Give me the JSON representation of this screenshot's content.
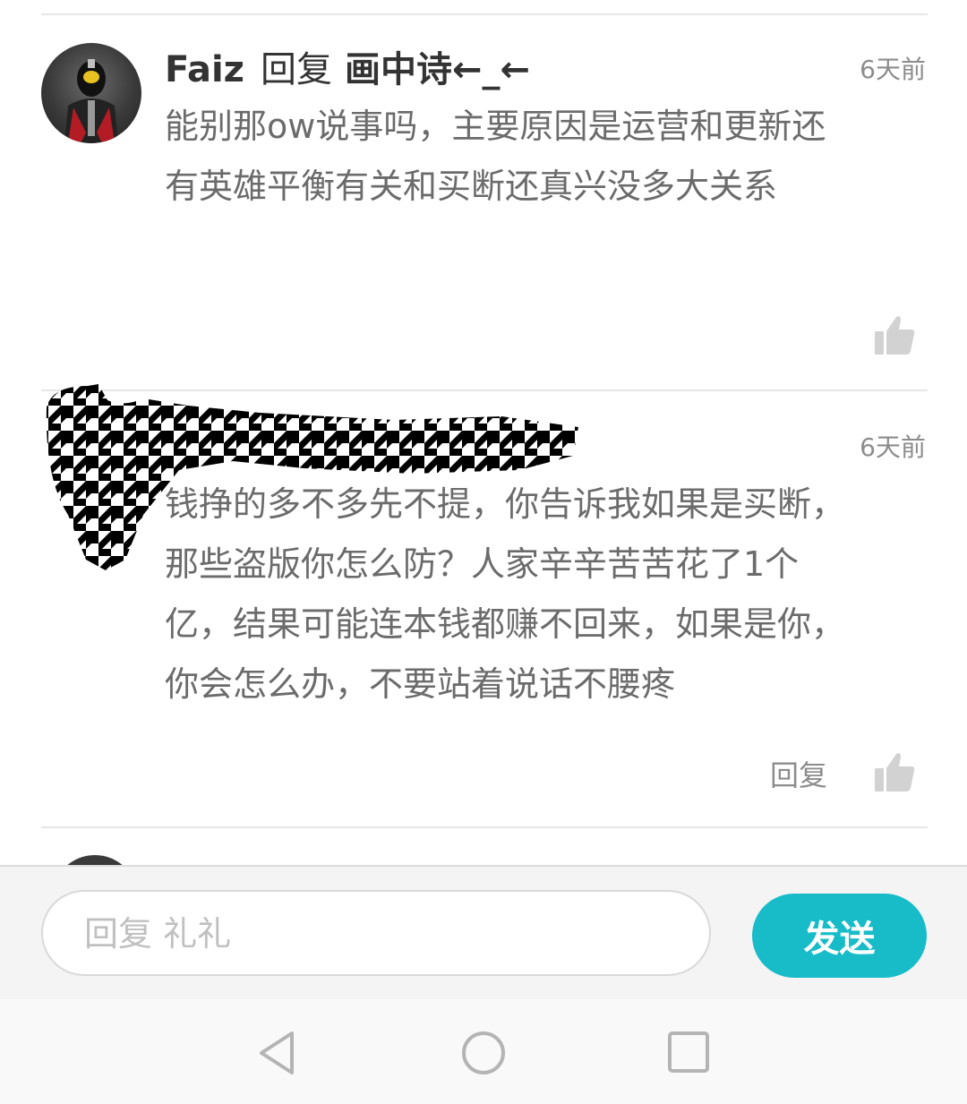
{
  "comments": [
    {
      "user": "Faiz",
      "reply_word": "回复",
      "reply_target": "画中诗←_←",
      "time": "6天前",
      "lines": [
        "能别那ow说事吗，主要原因是运营和更新还",
        "有英雄平衡有关和买断还真兴没多大关系"
      ]
    },
    {
      "user": "",
      "time": "6天前",
      "lines": [
        "钱挣的多不多先不提，你告诉我如果是买断，",
        "那些盗版你怎么防？人家辛辛苦苦花了1个",
        "亿，结果可能连本钱都赚不回来，如果是你，",
        "你会怎么办，不要站着说话不腰疼"
      ],
      "reply_label": "回复"
    }
  ],
  "composer": {
    "placeholder": "回复 礼礼",
    "send_label": "发送"
  },
  "icons": {
    "like": "thumbs-up-icon",
    "nav_back": "back-triangle-icon",
    "nav_home": "home-circle-icon",
    "nav_recents": "recents-square-icon"
  },
  "colors": {
    "accent": "#17bcc8",
    "time_text": "#8c8c8c",
    "body_text": "#6b6b6b"
  }
}
